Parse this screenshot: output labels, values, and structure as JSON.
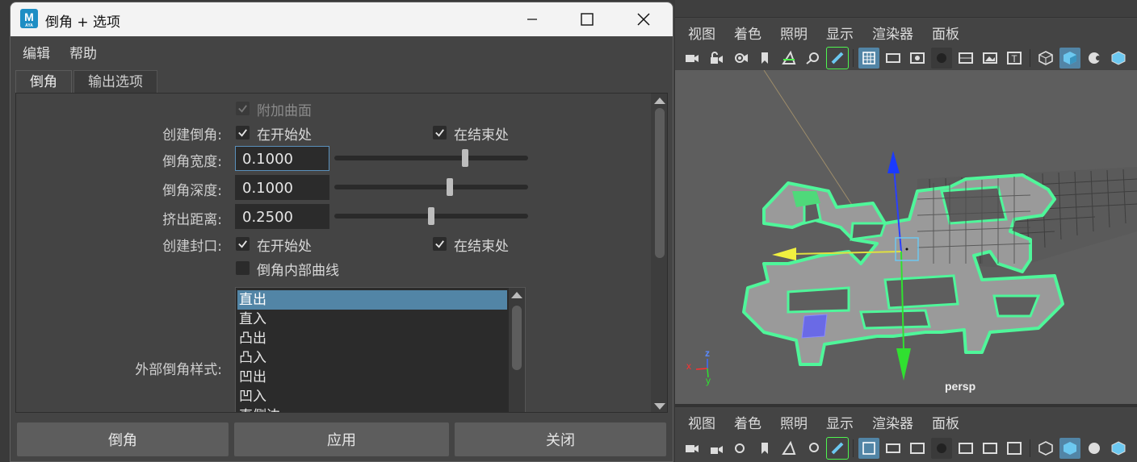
{
  "dialog": {
    "title": "倒角 + 选项",
    "app_icon_letter": "M",
    "app_icon_sub": "AYA",
    "menu": [
      "编辑",
      "帮助"
    ],
    "tabs": [
      "倒角",
      "输出选项"
    ],
    "attach_surface": {
      "label": "附加曲面",
      "checked": true,
      "disabled": true
    },
    "create_bevel": {
      "label": "创建倒角:",
      "at_start": "在开始处",
      "at_end": "在结束处",
      "start_checked": true,
      "end_checked": true
    },
    "bevel_width": {
      "label": "倒角宽度:",
      "value": "0.1000",
      "slider_fraction": 0.68
    },
    "bevel_depth": {
      "label": "倒角深度:",
      "value": "0.1000",
      "slider_fraction": 0.6
    },
    "extrude_distance": {
      "label": "挤出距离:",
      "value": "0.2500",
      "slider_fraction": 0.5
    },
    "create_cap": {
      "label": "创建封口:",
      "at_start": "在开始处",
      "at_end": "在结束处",
      "start_checked": true,
      "end_checked": true
    },
    "bevel_inner_curves": {
      "label": "倒角内部曲线",
      "checked": false
    },
    "outer_bevel_style": {
      "label": "外部倒角样式:",
      "options": [
        "直出",
        "直入",
        "凸出",
        "凸入",
        "凹出",
        "凹入",
        "直侧边"
      ],
      "selected": "直出"
    },
    "buttons": {
      "bevel": "倒角",
      "apply": "应用",
      "close": "关闭"
    }
  },
  "viewport": {
    "menu": [
      "视图",
      "着色",
      "照明",
      "显示",
      "渲染器",
      "面板"
    ],
    "camera_label": "persp",
    "axis_labels": {
      "x": "x",
      "y": "y",
      "z": "z"
    }
  },
  "colors": {
    "accent": "#5285a6",
    "wire_highlight": "#4ff64f"
  }
}
